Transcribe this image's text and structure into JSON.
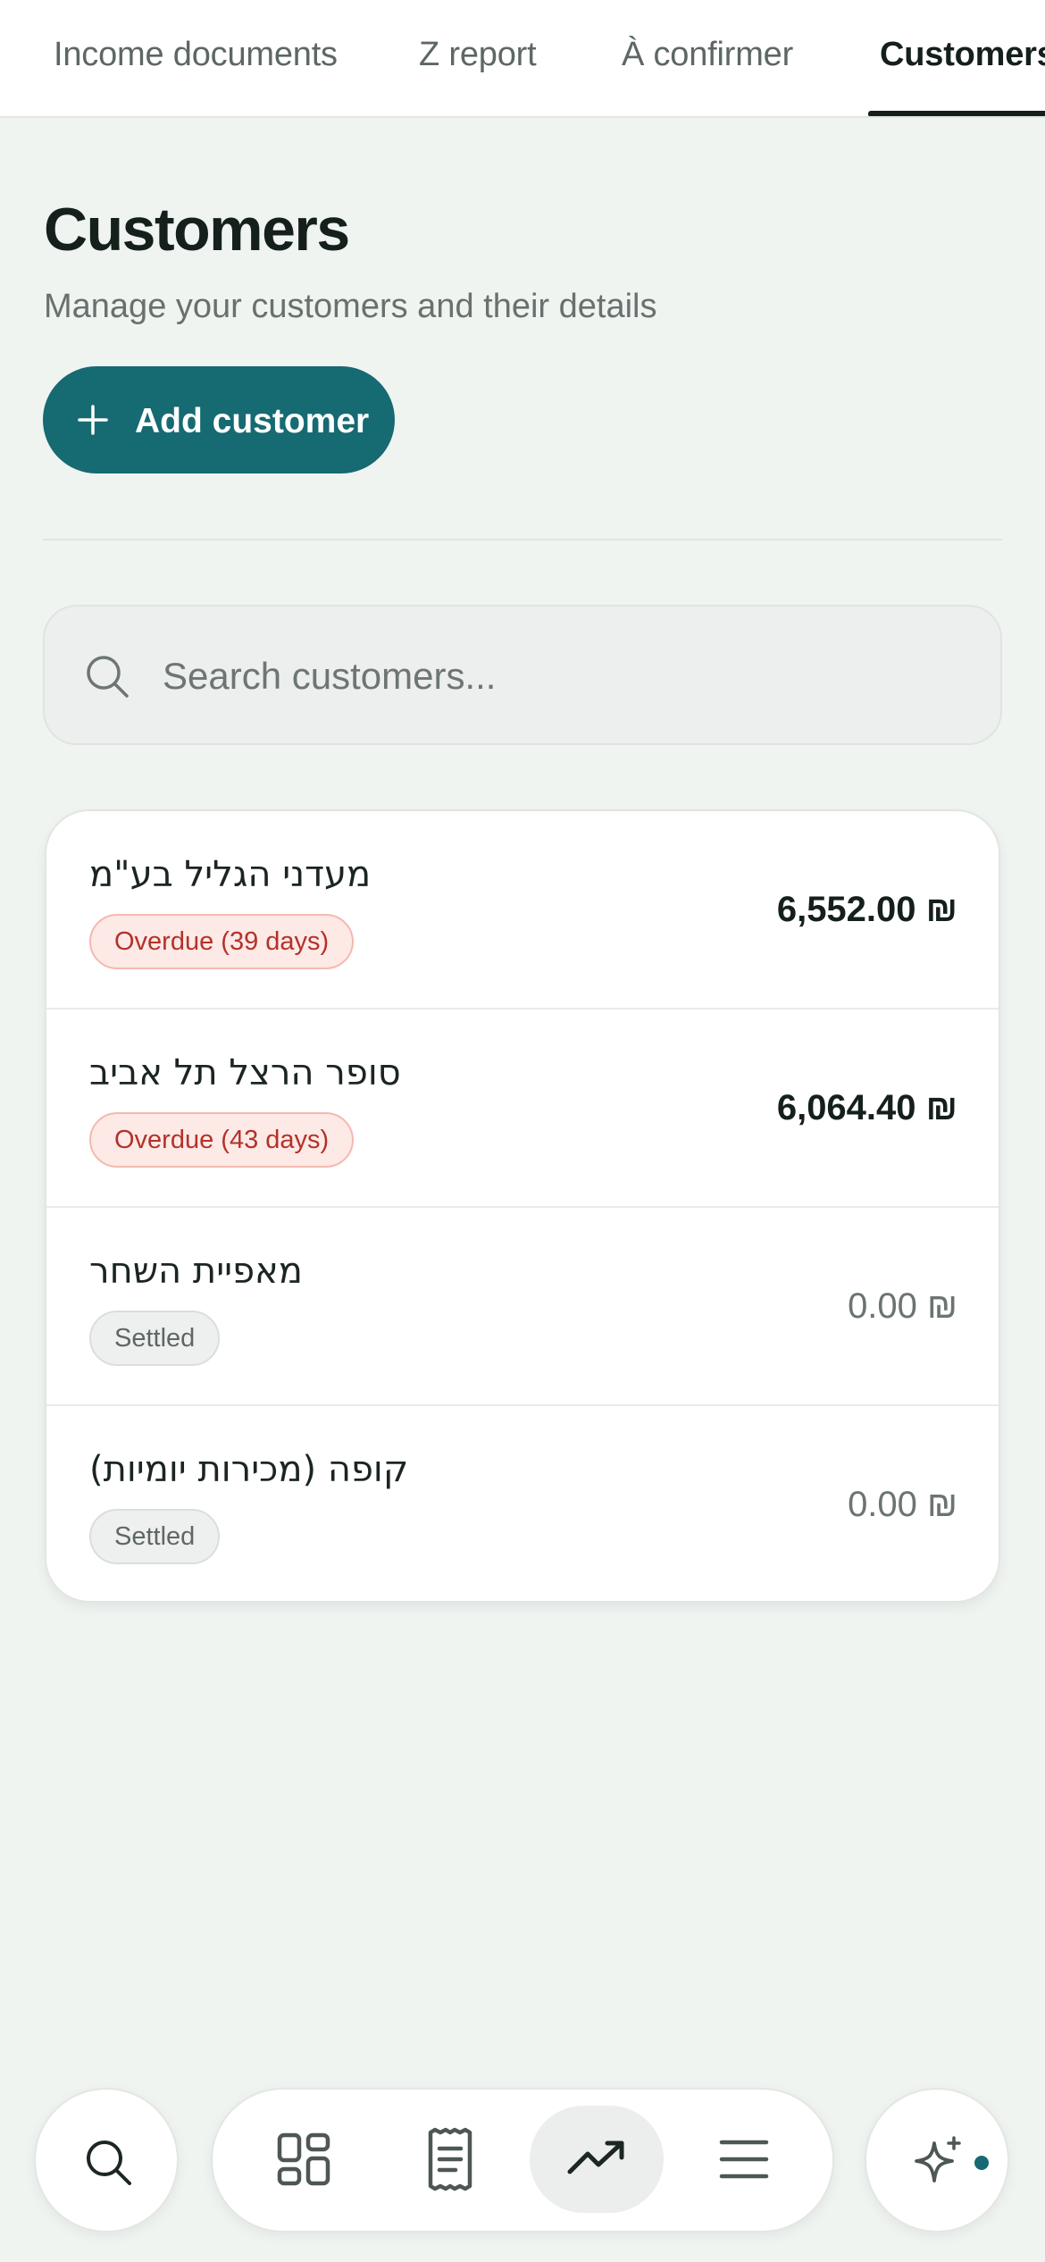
{
  "tabs": [
    {
      "label": "Income documents",
      "active": false
    },
    {
      "label": "Z report",
      "active": false
    },
    {
      "label": "À confirmer",
      "active": false
    },
    {
      "label": "Customers",
      "active": true
    }
  ],
  "header": {
    "title": "Customers",
    "subtitle": "Manage your customers and their details"
  },
  "add_button": {
    "label": "Add customer",
    "icon": "plus-icon"
  },
  "search": {
    "placeholder": "Search customers...",
    "value": "",
    "icon": "search-icon"
  },
  "customers": [
    {
      "name": "מעדני הגליל בע\"מ",
      "status": "Overdue (39 days)",
      "status_type": "overdue",
      "amount": "6,552.00 ₪"
    },
    {
      "name": "סופר הרצל תל אביב",
      "status": "Overdue (43 days)",
      "status_type": "overdue",
      "amount": "6,064.40 ₪"
    },
    {
      "name": "מאפיית השחר",
      "status": "Settled",
      "status_type": "settled",
      "amount": "0.00 ₪"
    },
    {
      "name": "קופה (מכירות יומיות)",
      "status": "Settled",
      "status_type": "settled",
      "amount": "0.00 ₪"
    }
  ],
  "bottom_nav": {
    "items": [
      "search-icon",
      "dashboard-icon",
      "receipt-icon",
      "trending-up-icon",
      "menu-icon",
      "sparkles-icon"
    ],
    "active": "trending-up-icon"
  },
  "colors": {
    "accent": "#166a72",
    "background": "#eff4f1",
    "overdue_text": "#b3322a",
    "overdue_bg": "#fde9e6",
    "settled_bg": "#eef0ef"
  }
}
